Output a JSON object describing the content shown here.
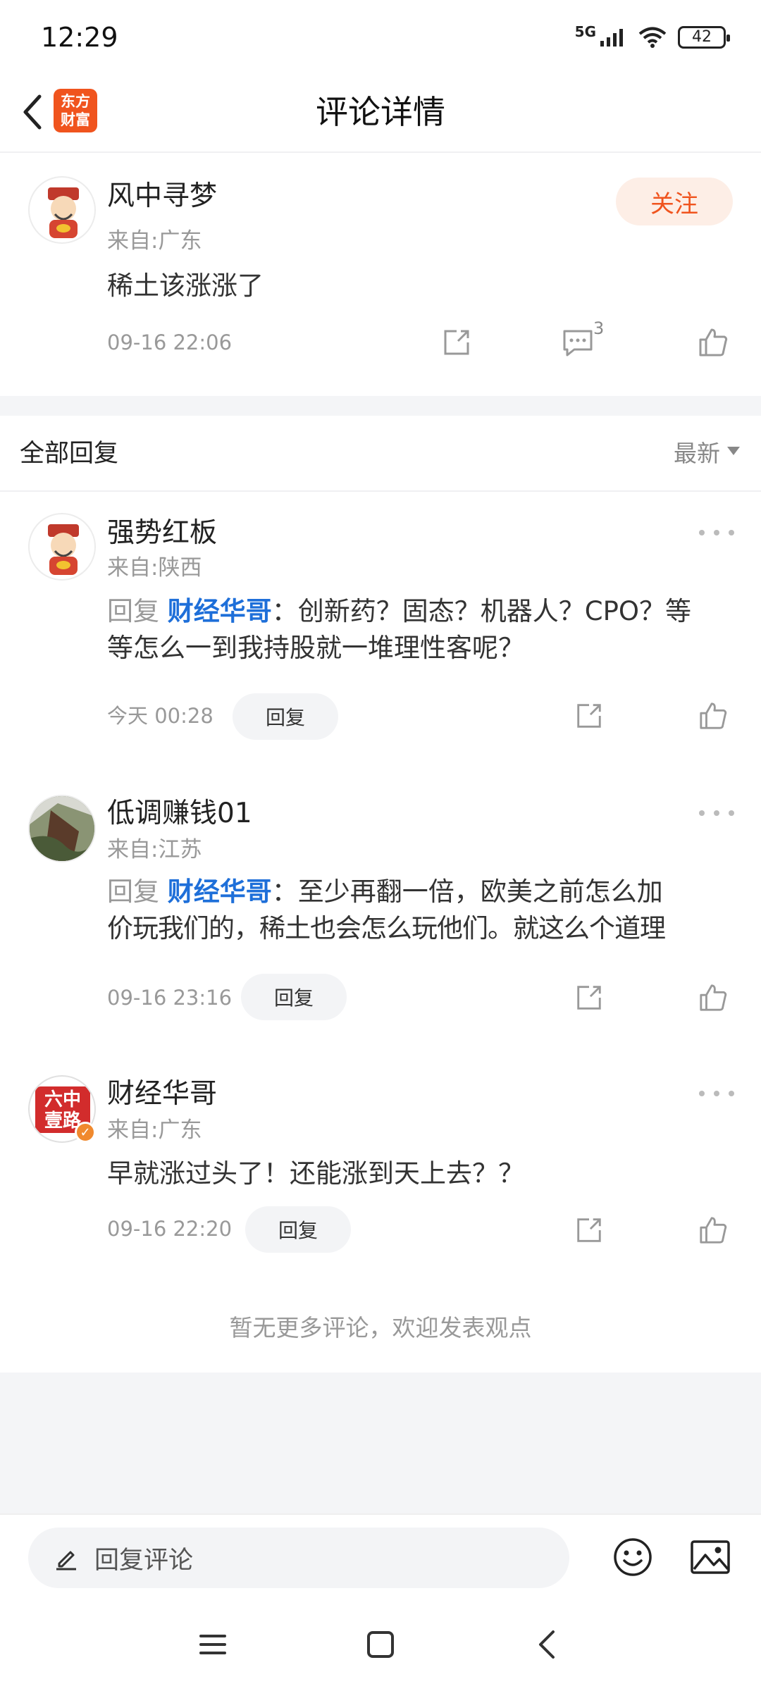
{
  "status_bar": {
    "time": "12:29",
    "network": "5G",
    "battery": "42"
  },
  "header": {
    "title": "评论详情",
    "logo_text": "东方财富"
  },
  "main_comment": {
    "user": "风中寻梦",
    "location": "来自:广东",
    "text": "稀土该涨涨了",
    "time": "09-16 22:06",
    "follow_label": "关注",
    "comment_count": "3"
  },
  "replies_section": {
    "title": "全部回复",
    "sort_label": "最新"
  },
  "replies": [
    {
      "user": "强势红板",
      "location": "来自:陕西",
      "prefix": "回复",
      "mention": "财经华哥",
      "line1": "：创新药？固态？机器人？CPO？等",
      "line2": "等怎么一到我持股就一堆理性客呢？",
      "time": "今天 00:28",
      "reply_label": "回复"
    },
    {
      "user": "低调赚钱01",
      "location": "来自:江苏",
      "prefix": "回复",
      "mention": "财经华哥",
      "line1": "：至少再翻一倍，欧美之前怎么加",
      "line2": "价玩我们的，稀土也会怎么玩他们。就这么个道理",
      "time": "09-16 23:16",
      "reply_label": "回复"
    },
    {
      "user": "财经华哥",
      "location": "来自:广东",
      "text": "早就涨过头了！还能涨到天上去？？",
      "time": "09-16 22:20",
      "reply_label": "回复",
      "avatar_text": "六中 壹路"
    }
  ],
  "end_note": "暂无更多评论，欢迎发表观点",
  "bottom_bar": {
    "placeholder": "回复评论"
  },
  "colors": {
    "accent": "#f0541e",
    "mention": "#1e6fd9",
    "muted": "#999999"
  },
  "icons": [
    "back-icon",
    "share-icon",
    "comment-icon",
    "like-icon",
    "more-icon",
    "pencil-icon",
    "emoji-icon",
    "image-icon"
  ]
}
